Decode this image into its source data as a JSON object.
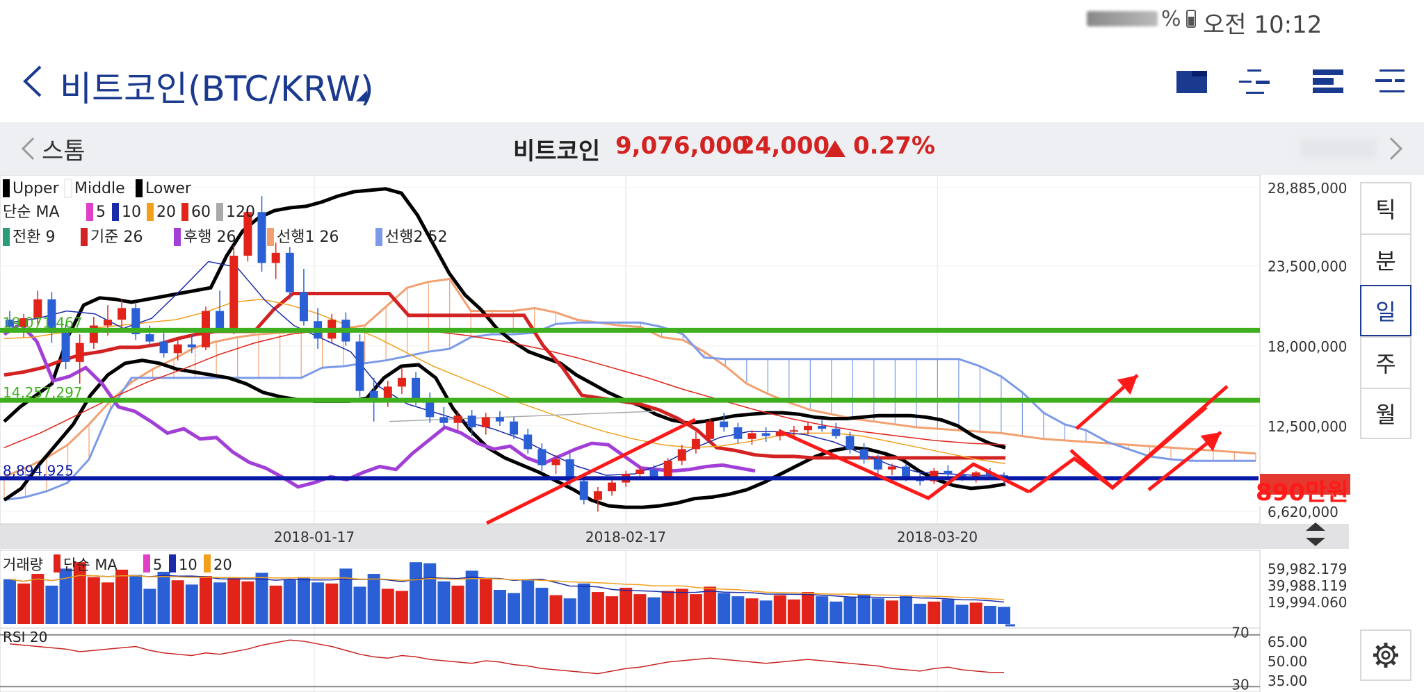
{
  "status": {
    "percent": "%",
    "time": "오전 10:12"
  },
  "header": {
    "title": "비트코인(BTC/KRW)"
  },
  "ticker": {
    "prev_label": "스톰",
    "name": "비트코인",
    "price": "9,076,000",
    "change": "24,000",
    "change_pct": "0.27%"
  },
  "period_tabs": [
    "틱",
    "분",
    "일",
    "주",
    "월"
  ],
  "period_active": "일",
  "icons": {
    "back": "back-arrow-icon",
    "layout1": "chart-layout-single-icon",
    "layout2": "chart-layout-split-icon",
    "layout3": "chart-layout-bar-icon",
    "layout4": "chart-layout-list-icon",
    "settings": "gear-icon",
    "resize": "resize-arrows-icon"
  },
  "colors": {
    "bull": "#e2231a",
    "bear": "#2a5fd6",
    "accent": "#1a3a8f",
    "support_green": "#3fae1f",
    "support_blue": "#0a1aa8",
    "annotation": "#ff1a1a"
  },
  "chart_data": {
    "type": "candlestick",
    "main": {
      "legend_rows": [
        [
          {
            "label": "Upper",
            "color": "#000000"
          },
          {
            "label": "Middle",
            "color": "#ffffff"
          },
          {
            "label": "Lower",
            "color": "#000000"
          }
        ],
        [
          {
            "label": "단순 MA",
            "color": null
          },
          {
            "label": "5",
            "color": "#e23fc7"
          },
          {
            "label": "10",
            "color": "#1a2aa8"
          },
          {
            "label": "20",
            "color": "#f2a01c"
          },
          {
            "label": "60",
            "color": "#e2231a"
          },
          {
            "label": "120",
            "color": "#aaaaaa"
          }
        ],
        [
          {
            "label": "전환 9",
            "color": "#2b9c7a"
          },
          {
            "label": "기준 26",
            "color": "#d32222"
          },
          {
            "label": "후행 26",
            "color": "#a23fd6"
          },
          {
            "label": "선행1 26",
            "color": "#f2a070"
          },
          {
            "label": "선행2 52",
            "color": "#7c9ae8"
          }
        ]
      ],
      "y_ticks": [
        "28,885,000",
        "23,500,000",
        "18,000,000",
        "12,500,000",
        "6,620,000"
      ],
      "x_ticks": [
        "2018-01-17",
        "2018-02-17",
        "2018-03-20"
      ],
      "level_labels": [
        "19,071,467",
        "14,257,297",
        "8,894,925"
      ],
      "annotation": "890만원",
      "candles_ohlc": [
        [
          19800000,
          20400000,
          18900000,
          19300000
        ],
        [
          19300000,
          20200000,
          18600000,
          19900000
        ],
        [
          19900000,
          21800000,
          19500000,
          21200000
        ],
        [
          21200000,
          21700000,
          18200000,
          18900000
        ],
        [
          18900000,
          19500000,
          16400000,
          16900000
        ],
        [
          16900000,
          18800000,
          15400000,
          18200000
        ],
        [
          18200000,
          20000000,
          17800000,
          19400000
        ],
        [
          19400000,
          20800000,
          18700000,
          19800000
        ],
        [
          19800000,
          21200000,
          19200000,
          20600000
        ],
        [
          20600000,
          21000000,
          18400000,
          18800000
        ],
        [
          18800000,
          19400000,
          17900000,
          18300000
        ],
        [
          18300000,
          18900000,
          17200000,
          17500000
        ],
        [
          17500000,
          18400000,
          17000000,
          18100000
        ],
        [
          18100000,
          18800000,
          17500000,
          17900000
        ],
        [
          17900000,
          20700000,
          17700000,
          20400000
        ],
        [
          20400000,
          21800000,
          18900000,
          19100000
        ],
        [
          19100000,
          24900000,
          18800000,
          24200000
        ],
        [
          24200000,
          27600000,
          23800000,
          27200000
        ],
        [
          27200000,
          28300000,
          23100000,
          23700000
        ],
        [
          23700000,
          25100000,
          22600000,
          24400000
        ],
        [
          24400000,
          24800000,
          21200000,
          21700000
        ],
        [
          21700000,
          23300000,
          19400000,
          19700000
        ],
        [
          19700000,
          20600000,
          17800000,
          18500000
        ],
        [
          18500000,
          20200000,
          18200000,
          19800000
        ],
        [
          19800000,
          20300000,
          18000000,
          18300000
        ],
        [
          18300000,
          18800000,
          14500000,
          14900000
        ],
        [
          14900000,
          15800000,
          12800000,
          14200000
        ],
        [
          14200000,
          15600000,
          13800000,
          15200000
        ],
        [
          15200000,
          16500000,
          14700000,
          15800000
        ],
        [
          15800000,
          16200000,
          13900000,
          14300000
        ],
        [
          14300000,
          14800000,
          12700000,
          13100000
        ],
        [
          13100000,
          13800000,
          12300000,
          12700000
        ],
        [
          12700000,
          13500000,
          12200000,
          13200000
        ],
        [
          13200000,
          13600000,
          11800000,
          12400000
        ],
        [
          12400000,
          13400000,
          11900000,
          13100000
        ],
        [
          13100000,
          13500000,
          12500000,
          12800000
        ],
        [
          12800000,
          13100000,
          11600000,
          11900000
        ],
        [
          11900000,
          12300000,
          10600000,
          10900000
        ],
        [
          10900000,
          11300000,
          9400000,
          9800000
        ],
        [
          9800000,
          10500000,
          9200000,
          10200000
        ],
        [
          10200000,
          10600000,
          8300000,
          8700000
        ],
        [
          8700000,
          9100000,
          7100000,
          7400000
        ],
        [
          7400000,
          8300000,
          6600000,
          8000000
        ],
        [
          8000000,
          8900000,
          7700000,
          8600000
        ],
        [
          8600000,
          9400000,
          8300000,
          9200000
        ],
        [
          9200000,
          9700000,
          8800000,
          9500000
        ],
        [
          9500000,
          9800000,
          8800000,
          9000000
        ],
        [
          9000000,
          10300000,
          8800000,
          10100000
        ],
        [
          10100000,
          11200000,
          9800000,
          10900000
        ],
        [
          10900000,
          12100000,
          10600000,
          11600000
        ],
        [
          11600000,
          13000000,
          11400000,
          12800000
        ],
        [
          12800000,
          13400000,
          12100000,
          12400000
        ],
        [
          12400000,
          12700000,
          11300000,
          11600000
        ],
        [
          11600000,
          12200000,
          11200000,
          12000000
        ],
        [
          12000000,
          12400000,
          11400000,
          11800000
        ],
        [
          11800000,
          12300000,
          11500000,
          12100000
        ],
        [
          12100000,
          12500000,
          11700000,
          12200000
        ],
        [
          12200000,
          12800000,
          11900000,
          12500000
        ],
        [
          12500000,
          12900000,
          12100000,
          12300000
        ],
        [
          12300000,
          12700000,
          11600000,
          11800000
        ],
        [
          11800000,
          12100000,
          10600000,
          10900000
        ],
        [
          10900000,
          11300000,
          9900000,
          10200000
        ],
        [
          10200000,
          10500000,
          9200000,
          9500000
        ],
        [
          9500000,
          9900000,
          9100000,
          9700000
        ],
        [
          9700000,
          9900000,
          8700000,
          8900000
        ],
        [
          8900000,
          9300000,
          8400000,
          8700000
        ],
        [
          8700000,
          9600000,
          8500000,
          9400000
        ],
        [
          9400000,
          9800000,
          9000000,
          9200000
        ],
        [
          9200000,
          9500000,
          8700000,
          8900000
        ],
        [
          8900000,
          9400000,
          8600000,
          9300000
        ],
        [
          9300000,
          9600000,
          8900000,
          9100000
        ],
        [
          9100000,
          9300000,
          8500000,
          8800000
        ]
      ]
    },
    "volume": {
      "legend": [
        {
          "label": "거래량",
          "color": null
        },
        {
          "label": "단순 MA",
          "color": "#e2231a"
        },
        {
          "label": "5",
          "color": "#e23fc7"
        },
        {
          "label": "10",
          "color": "#1a2aa8"
        },
        {
          "label": "20",
          "color": "#f2a01c"
        }
      ],
      "y_ticks": [
        "59,982.179",
        "39,988.119",
        "19,994.060"
      ],
      "values": [
        42000,
        38000,
        47000,
        36000,
        52000,
        58000,
        44000,
        39000,
        51000,
        46000,
        33000,
        49000,
        41000,
        37000,
        45000,
        39000,
        43000,
        40000,
        48000,
        36000,
        42000,
        44000,
        39000,
        38000,
        52000,
        35000,
        47000,
        33000,
        31000,
        58000,
        57000,
        40000,
        36000,
        50000,
        43000,
        32000,
        29000,
        41000,
        34000,
        27000,
        24000,
        38000,
        30000,
        26000,
        34000,
        28000,
        25000,
        31000,
        33000,
        28000,
        35000,
        29000,
        26000,
        24000,
        22000,
        27000,
        23000,
        30000,
        26000,
        21000,
        25000,
        28000,
        24000,
        22000,
        26000,
        19000,
        21000,
        23000,
        18000,
        20000,
        17000,
        16000
      ]
    },
    "rsi": {
      "label": "RSI 20",
      "y_ticks": [
        "65.00",
        "50.00",
        "35.00"
      ],
      "bounds": [
        "70",
        "30"
      ],
      "values": [
        63,
        62,
        61,
        60,
        59,
        57,
        58,
        59,
        60,
        61,
        58,
        56,
        55,
        54,
        56,
        55,
        57,
        59,
        62,
        64,
        66,
        65,
        63,
        61,
        58,
        55,
        53,
        52,
        54,
        53,
        51,
        50,
        49,
        48,
        50,
        49,
        47,
        46,
        44,
        43,
        42,
        41,
        40,
        42,
        44,
        45,
        47,
        49,
        50,
        51,
        52,
        51,
        50,
        49,
        48,
        49,
        50,
        51,
        50,
        49,
        48,
        47,
        46,
        44,
        43,
        42,
        44,
        45,
        43,
        42,
        41,
        41
      ]
    }
  }
}
